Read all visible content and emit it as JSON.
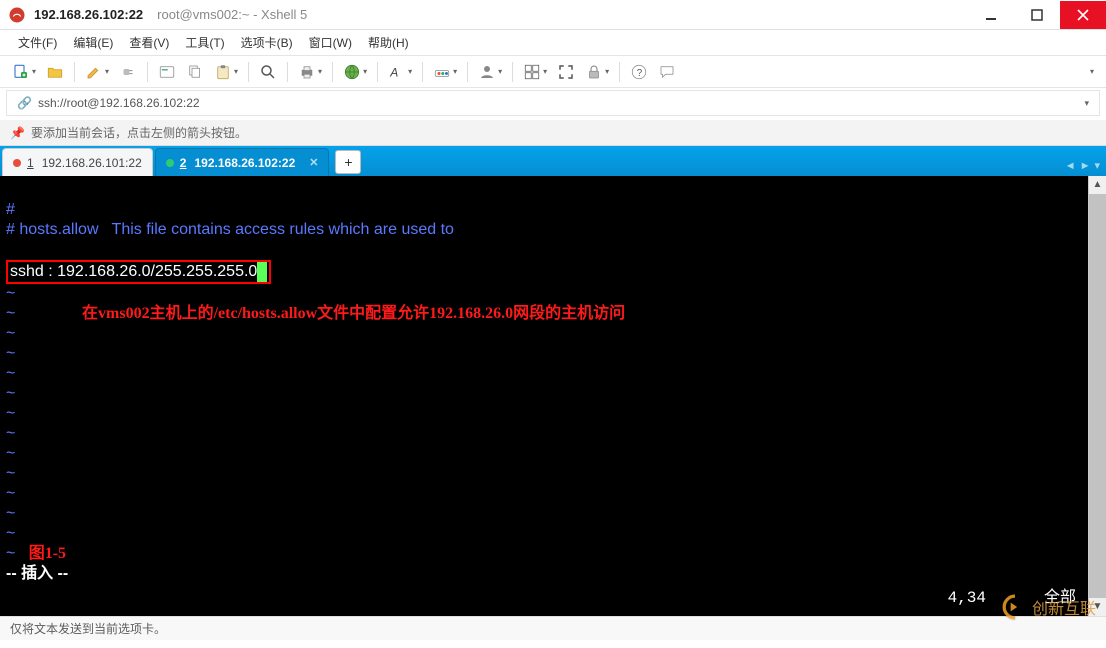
{
  "titlebar": {
    "main": "192.168.26.102:22",
    "sub": "root@vms002:~ - Xshell 5"
  },
  "menu": {
    "file": "文件(F)",
    "edit": "编辑(E)",
    "view": "查看(V)",
    "tools": "工具(T)",
    "tab": "选项卡(B)",
    "window": "窗口(W)",
    "help": "帮助(H)"
  },
  "address": {
    "url": "ssh://root@192.168.26.102:22"
  },
  "infobar": {
    "text": "要添加当前会话，点击左侧的箭头按钮。"
  },
  "tabs": {
    "t1_num": "1",
    "t1_label": "192.168.26.101:22",
    "t2_num": "2",
    "t2_label": "192.168.26.102:22",
    "add": "+"
  },
  "terminal": {
    "line1": "#",
    "line2_a": "# hosts.allow",
    "line2_b": "This file contains access rules which are used to",
    "rule": "sshd : 192.168.26.0/255.255.255.0",
    "annotation": "在vms002主机上的/etc/hosts.allow文件中配置允许192.168.26.0网段的主机访问",
    "figlabel": "图1-5",
    "modeline": "-- 插入 --",
    "pos": "4,34",
    "all": "全部"
  },
  "status": {
    "text": "仅将文本发送到当前选项卡。"
  },
  "watermark": "创新互联"
}
